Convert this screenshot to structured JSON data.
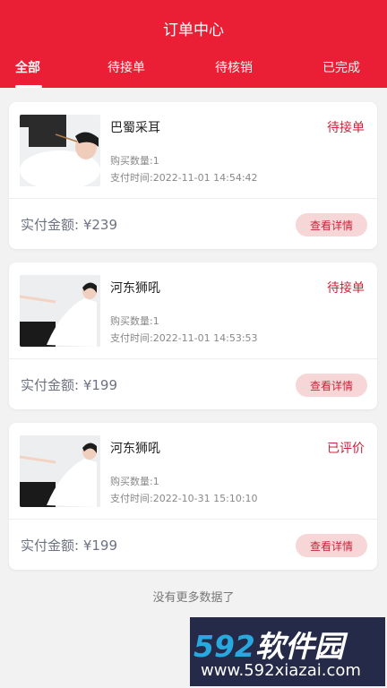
{
  "header": {
    "title": "订单中心"
  },
  "tabs": [
    {
      "label": "全部",
      "active": true
    },
    {
      "label": "待接单",
      "active": false
    },
    {
      "label": "待核销",
      "active": false
    },
    {
      "label": "已完成",
      "active": false
    }
  ],
  "orders": [
    {
      "name": "巴蜀采耳",
      "status": "待接单",
      "quantity": "购买数量:1",
      "pay_time": "支付时间:2022-11-01 14:54:42",
      "amount": "实付金额: ¥239",
      "detail_label": "查看详情"
    },
    {
      "name": "河东狮吼",
      "status": "待接单",
      "quantity": "购买数量:1",
      "pay_time": "支付时间:2022-11-01 14:53:53",
      "amount": "实付金额: ¥199",
      "detail_label": "查看详情"
    },
    {
      "name": "河东狮吼",
      "status": "已评价",
      "quantity": "购买数量:1",
      "pay_time": "支付时间:2022-10-31 15:10:10",
      "amount": "实付金额: ¥199",
      "detail_label": "查看详情"
    }
  ],
  "footer": {
    "no_more": "没有更多数据了"
  },
  "watermark": {
    "logo_num": "592",
    "logo_text": "软件园",
    "url": "www.592xiazai.com"
  },
  "colors": {
    "brand_red": "#ea1f36",
    "status_red": "#c8243a",
    "detail_bg": "#f7d6d8"
  }
}
